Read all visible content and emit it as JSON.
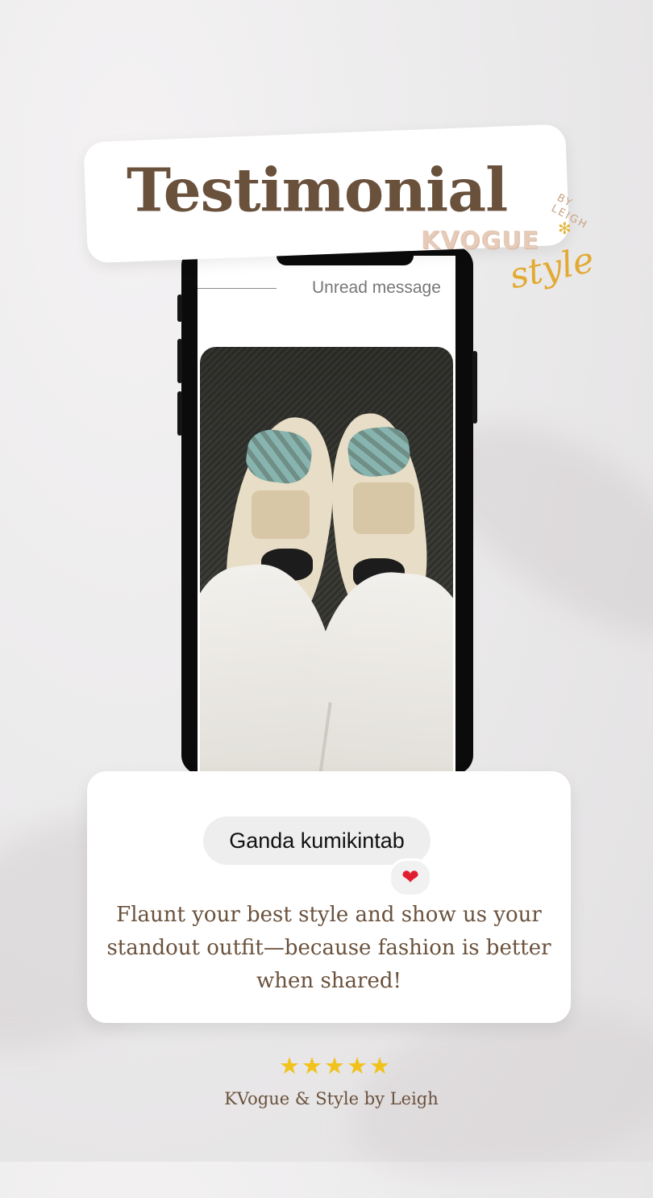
{
  "title": "Testimonial",
  "logo": {
    "by_text": "BY LEIGH",
    "brand_text": "KVOGUE",
    "script_text": "style"
  },
  "chat": {
    "header_text": "Unread message",
    "photo_description": "",
    "message_text": "Ganda kumikintab",
    "reaction": "❤"
  },
  "caption": "Flaunt your best style and show us your standout outfit—because fashion is better when shared!",
  "rating": {
    "stars": 5,
    "star_glyphs": "★★★★★"
  },
  "footer_text": "KVogue  & Style by Leigh",
  "colors": {
    "title_brown": "#6a513c",
    "star_gold": "#f0c21b",
    "heart_red": "#e01e2f",
    "logo_gold": "#e2aa34",
    "logo_peach": "#e6cbb9"
  }
}
